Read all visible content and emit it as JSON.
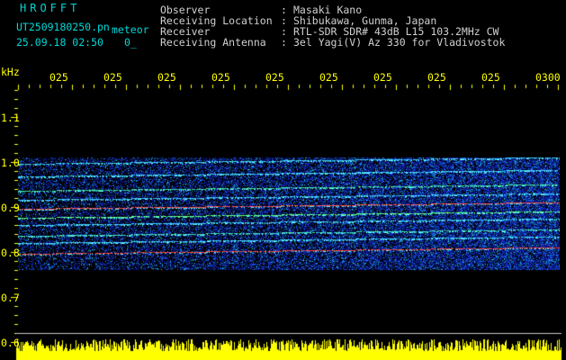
{
  "header": {
    "app_title": "HROFFT",
    "file_name": "UT2509180250.pn",
    "file_type": "meteor",
    "date_time": "25.09.18 02:50",
    "date_extra": "0_"
  },
  "info": [
    {
      "label": "Observer",
      "value": "Masaki Kano"
    },
    {
      "label": "Receiving Location",
      "value": "Shibukawa, Gunma, Japan"
    },
    {
      "label": "Receiver",
      "value": "RTL-SDR SDR# 43dB L15 103.2MHz CW"
    },
    {
      "label": "Receiving Antenna",
      "value": "3el Yagi(V) Az 330 for Vladivostok"
    }
  ],
  "separator": ":",
  "axis": {
    "y_unit": "kHz",
    "y_ticks": [
      "1.1",
      "1.0",
      "0.9",
      "0.8",
      "0.7",
      "0.6"
    ],
    "time_labels": [
      "025",
      "025",
      "025",
      "025",
      "025",
      "025",
      "025",
      "025",
      "025",
      "0300"
    ]
  },
  "colors": {
    "header_cyan": "#00d8d8",
    "axis_yellow": "#ffff00",
    "info_text": "#d0d0d0",
    "background": "#000000"
  }
}
